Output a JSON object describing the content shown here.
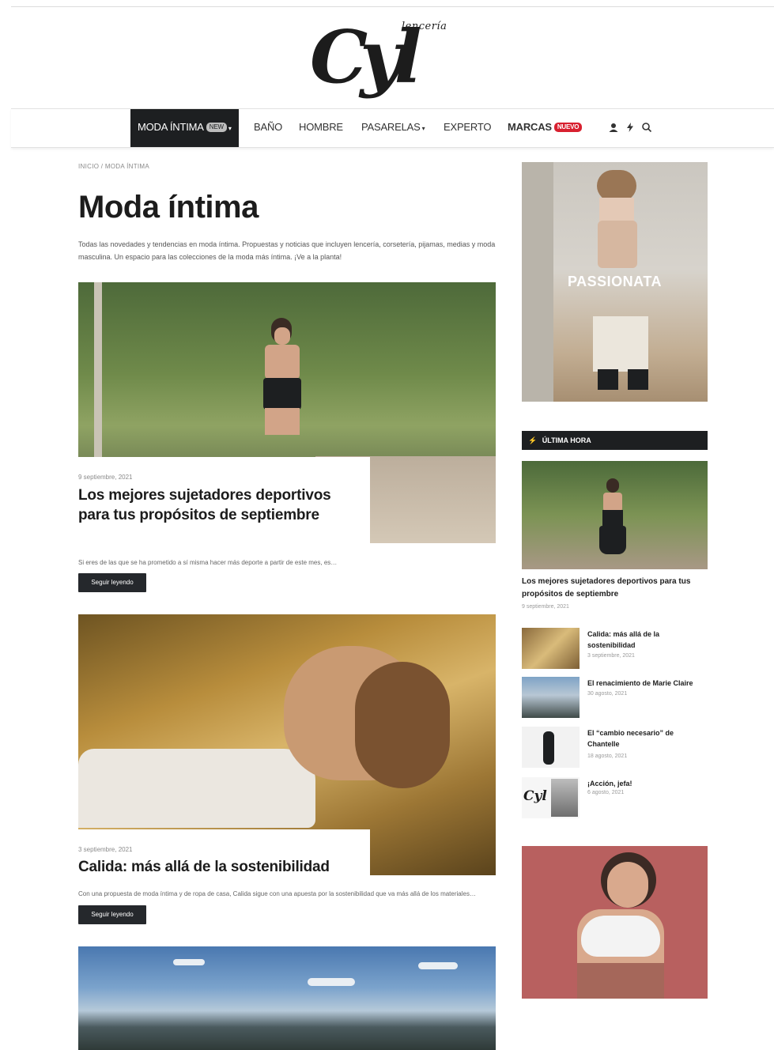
{
  "site": {
    "logo_text": "Cyl",
    "logo_tagline": "lencería"
  },
  "nav": {
    "items": [
      {
        "label": "MODA ÍNTIMA",
        "badge": "NEW",
        "caret": "▾"
      },
      {
        "label": "BAÑO"
      },
      {
        "label": "HOMBRE"
      },
      {
        "label": "PASARELAS",
        "caret": "▾"
      },
      {
        "label": "EXPERTO"
      },
      {
        "label": "MARCAS",
        "badge": "NUEVO"
      }
    ],
    "icons": [
      "user-icon",
      "lightning-icon",
      "search-icon"
    ],
    "colors": {
      "active_bg": "#1d1f21",
      "badge_red": "#d8202f"
    }
  },
  "breadcrumb": "INICIO / MODA ÍNTIMA",
  "page": {
    "title": "Moda íntima",
    "intro": "Todas las novedades y tendencias en moda íntima. Propuestas y noticias que incluyen lencería, corsetería, pijamas, medias y moda masculina. Un espacio para las colecciones de la moda más íntima. ¡Ve a la planta!"
  },
  "articles": [
    {
      "date": "9 septiembre, 2021",
      "title": "Los mejores sujetadores deportivos para tus propósitos de septiembre",
      "excerpt": "Si eres de las que se ha prometido a sí misma hacer más deporte a partir de este mes, es…",
      "button": "Seguir leyendo"
    },
    {
      "date": "3 septiembre, 2021",
      "title": "Calida: más allá de la sostenibilidad",
      "excerpt": "Con una propuesta de moda íntima y de ropa de casa, Calida sigue con una apuesta por la sostenibilidad que va más allá de los materiales…",
      "button": "Seguir leyendo"
    }
  ],
  "sidebar": {
    "promo_top": "PASSIONATA",
    "section_title": "ÚLTIMA HORA",
    "featured": {
      "title": "Los mejores sujetadores deportivos para tus propósitos de septiembre",
      "date": "9 septiembre, 2021"
    },
    "list": [
      {
        "title": "Calida: más allá de la sostenibilidad",
        "date": "3 septiembre, 2021"
      },
      {
        "title": "El renacimiento de Marie Claire",
        "date": "30 agosto, 2021"
      },
      {
        "title": "El “cambio necesario” de Chantelle",
        "date": "18 agosto, 2021"
      },
      {
        "title": "¡Acción, jefa!",
        "date": "6 agosto, 2021"
      }
    ]
  }
}
